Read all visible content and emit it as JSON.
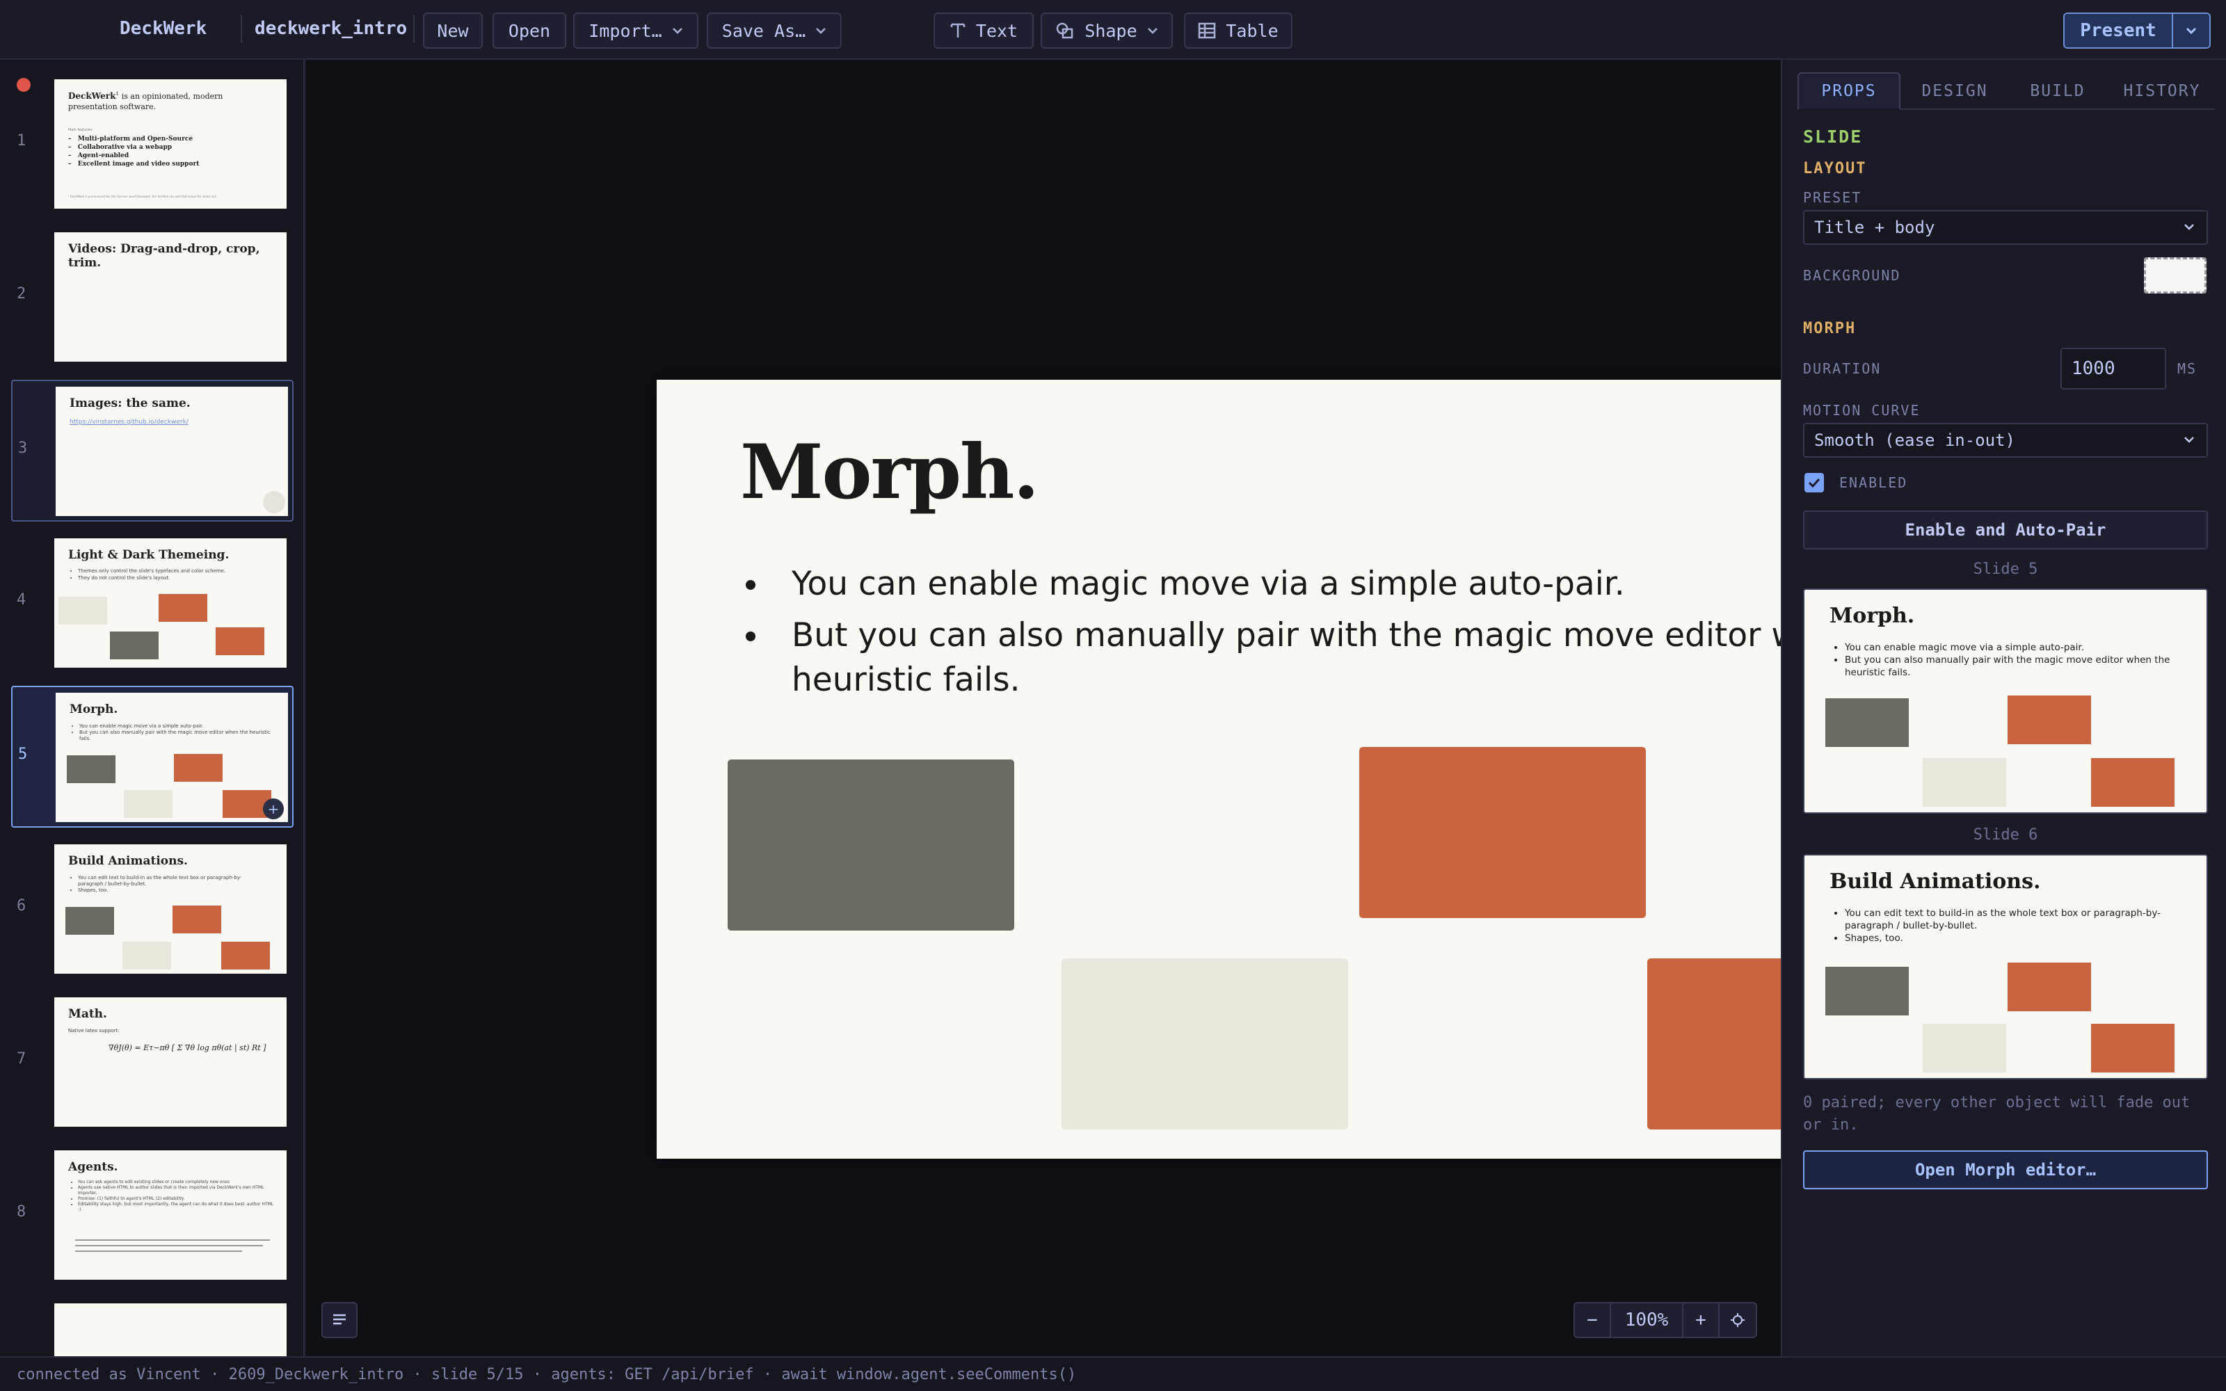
{
  "app": {
    "name": "DeckWerk",
    "document": "deckwerk_intro"
  },
  "toolbar": {
    "new": "New",
    "open": "Open",
    "import": "Import…",
    "save_as": "Save As…",
    "text": "Text",
    "shape": "Shape",
    "table": "Table",
    "present": "Present"
  },
  "slides": [
    {
      "num": "1",
      "title": "DeckWerk",
      "sup": "1",
      "subtitle": "is an opinionated, modern presentation software.",
      "list_head": "Main features:",
      "bullets": [
        "Multi-platform and Open-Source",
        "Collaborative via a webapp",
        "Agent-enabled",
        "Excellent image and video support"
      ],
      "footnote": "¹ DeckWerk is pronounced like the German word Deckwerk: the fortified sea wall that keeps the water out."
    },
    {
      "num": "2",
      "title": "Videos: Drag-and-drop, crop, trim."
    },
    {
      "num": "3",
      "title": "Images: the same.",
      "link": "https://vinstarnes.github.io/deckwerk/"
    },
    {
      "num": "4",
      "title": "Light & Dark Themeing.",
      "bullets": [
        "Themes only control the slide's typefaces and color scheme.",
        "They do not control the slide's layout."
      ]
    },
    {
      "num": "5",
      "title": "Morph.",
      "bullets": [
        "You can enable magic move via a simple auto-pair.",
        "But you can also manually pair with the magic move editor when the heuristic fails."
      ]
    },
    {
      "num": "6",
      "title": "Build Animations.",
      "bullets": [
        "You can edit text to build-in as the whole text box or paragraph-by-paragraph / bullet-by-bullet.",
        "Shapes, too."
      ]
    },
    {
      "num": "7",
      "title": "Math.",
      "body": "Native latex support:",
      "formula": "∇θJ(θ) = Eτ∼πθ [ Σ ∇θ log πθ(at | st) Rt ]"
    },
    {
      "num": "8",
      "title": "Agents.",
      "bullets": [
        "You can ask agents to edit existing slides or create completely new ones",
        "Agents use native HTML to author slides that is then imported via DeckWerk's own HTML Importer.",
        "Promise: (1) faithful to agent's HTML (2) editability.",
        "Editability stays high, but most importantly, the agent can do what it does best: author HTML :)"
      ]
    }
  ],
  "current_slide": {
    "title": "Morph.",
    "bullets": [
      "You can enable magic move via a simple auto-pair.",
      "But you can also manually pair with the magic move editor when the heuristic fails."
    ]
  },
  "zoom": {
    "minus": "−",
    "value": "100%",
    "plus": "+"
  },
  "panel": {
    "tabs": [
      "PROPS",
      "DESIGN",
      "BUILD",
      "HISTORY"
    ],
    "section": "SLIDE",
    "layout": {
      "heading": "LAYOUT",
      "preset_label": "PRESET",
      "preset_value": "Title + body",
      "background_label": "BACKGROUND"
    },
    "morph": {
      "heading": "MORPH",
      "duration_label": "DURATION",
      "duration_value": "1000",
      "duration_unit": "MS",
      "curve_label": "MOTION CURVE",
      "curve_value": "Smooth (ease in-out)",
      "enabled_label": "ENABLED",
      "enabled": true,
      "auto_pair_button": "Enable and Auto-Pair",
      "from_caption": "Slide 5",
      "to_caption": "Slide 6",
      "note": "0 paired; every other object will fade out or in.",
      "editor_button": "Open Morph editor…"
    }
  },
  "status": "connected as Vincent · 2609_Deckwerk_intro · slide 5/15 · agents: GET /api/brief · await window.agent.seeComments()",
  "colors": {
    "accent": "#7aa2f7",
    "shape_gray": "#6b6a60",
    "shape_orange": "#c96441",
    "shape_cream": "#ece7dc",
    "slide_bg": "#faf8f3"
  }
}
